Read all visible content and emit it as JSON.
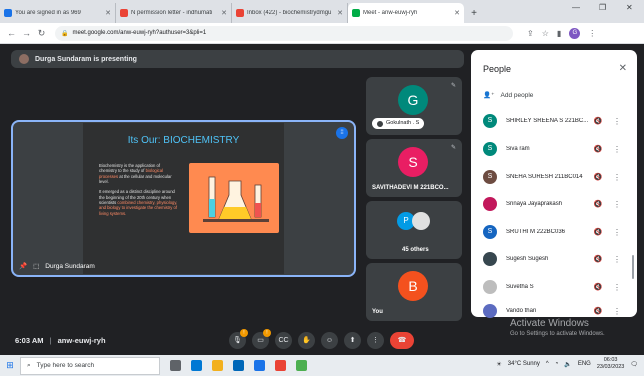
{
  "browser": {
    "tabs": [
      {
        "title": "You are signed in as 969",
        "icon_color": "#1a73e8",
        "active": false
      },
      {
        "title": "N permission letter - indhumati",
        "icon_color": "#ea4335",
        "active": false
      },
      {
        "title": "Inbox (422) - biochemistrydmgu",
        "icon_color": "#ea4335",
        "active": false
      },
      {
        "title": "Meet - anw-euwj-ryh",
        "icon_color": "#00ac47",
        "active": true
      }
    ],
    "new_tab": "+",
    "url": "meet.google.com/anw-euwj-ryh?authuser=3&pli=1",
    "profile_initial": "G"
  },
  "meet": {
    "presenting_banner": "Durga Sundaram is presenting",
    "main_tile": {
      "name": "Durga Sundaram",
      "slide": {
        "title": "Its Our: BIOCHEMISTRY",
        "body_1": "Biochemistry is the application of chemistry to the study of",
        "body_1_hl": "biological processes",
        "body_1b": "at the cellular and molecular level.",
        "body_2": "It emerged as a distinct discipline around the beginning of the 20th century when scientists",
        "body_2_hl": "combined chemistry, physiology, and biology to investigate the chemistry of living systems."
      }
    },
    "side_tiles": [
      {
        "initial": "G",
        "name": "Gokulnath . S",
        "color": "#00897b"
      },
      {
        "initial": "S",
        "name": "SAVITHADEVI M 221BCO...",
        "color": "#e91e63"
      },
      {
        "initial": "P",
        "name": "45 others",
        "color": "#039be5"
      },
      {
        "initial": "B",
        "name": "You",
        "color": "#f4511e"
      }
    ],
    "time": "6:03 AM",
    "meeting_code": "anw-euwj-ryh",
    "controls": [
      {
        "name": "mic-off-icon",
        "glyph": "🎙"
      },
      {
        "name": "camera-off-icon",
        "glyph": "▭"
      },
      {
        "name": "captions-icon",
        "glyph": "CC"
      },
      {
        "name": "raise-hand-icon",
        "glyph": "✋"
      },
      {
        "name": "emoji-icon",
        "glyph": "☺"
      },
      {
        "name": "present-icon",
        "glyph": "⬆"
      },
      {
        "name": "more-icon",
        "glyph": "⋮"
      },
      {
        "name": "end-call-icon",
        "glyph": "☎"
      }
    ],
    "badge_count_1": "!",
    "badge_count_2": "!"
  },
  "people": {
    "title": "People",
    "add_people": "Add people",
    "list": [
      {
        "name": "SHIRLEY SREENA S 221BC...",
        "initial": "S",
        "color": "#00897b"
      },
      {
        "name": "Siva ram",
        "initial": "S",
        "color": "#00897b"
      },
      {
        "name": "SNEHA SURESH 211BC014",
        "initial": "S",
        "color": "#6d4c41"
      },
      {
        "name": "Srinaya Jayaprakash",
        "initial": "",
        "color": "#c2185b"
      },
      {
        "name": "SRUTHI M 222BC036",
        "initial": "S",
        "color": "#1565c0"
      },
      {
        "name": "Sugesh Sugesh",
        "initial": "",
        "color": "#37474f"
      },
      {
        "name": "Suvetha S",
        "initial": "",
        "color": "#bdbdbd"
      },
      {
        "name": "Vando thari",
        "initial": "",
        "color": "#5c6bc0"
      }
    ]
  },
  "watermark": {
    "line1": "Activate Windows",
    "line2": "Go to Settings to activate Windows."
  },
  "taskbar": {
    "search_placeholder": "Type here to search",
    "weather": "34°C  Sunny",
    "lang": "ENG",
    "time": "06:03",
    "date": "23/03/2023"
  }
}
